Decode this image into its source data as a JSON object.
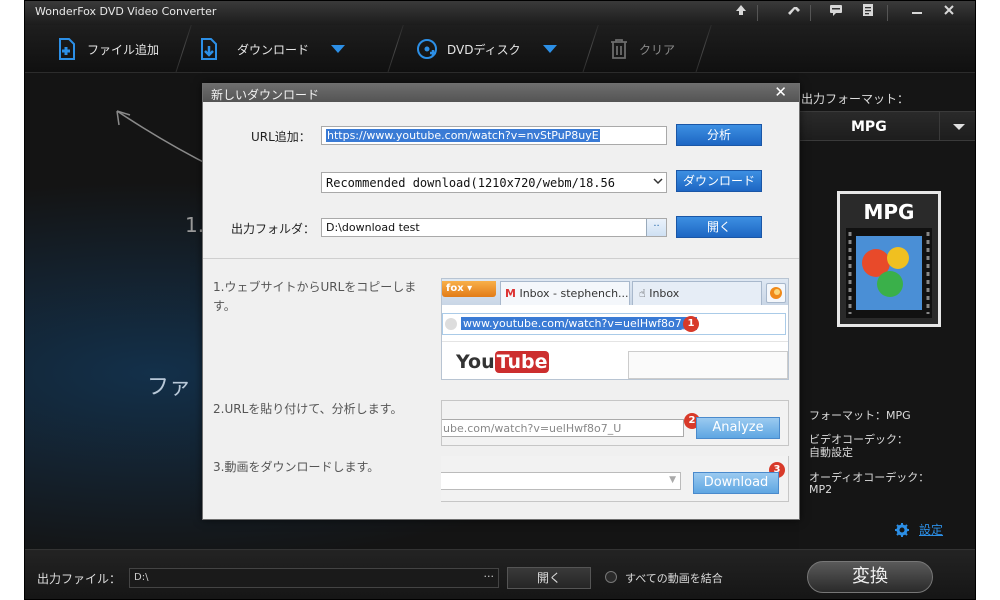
{
  "window": {
    "title": "WonderFox DVD Video Converter"
  },
  "toolbar": {
    "add_file": "ファイル追加",
    "download": "ダウンロード",
    "dvd_disc": "DVDディスク",
    "clear": "クリア"
  },
  "background": {
    "step_number": "1.",
    "step_text_partial": "ファ"
  },
  "right_panel": {
    "output_format_label": "出力フォーマット：",
    "format_value": "MPG",
    "format_icon_text": "MPG",
    "format_info": "フォーマット：MPG",
    "video_codec_label": "ビデオコーデック：",
    "video_codec_value": "自動設定",
    "audio_codec_label": "オーディオコーデック：",
    "audio_codec_value": "MP2",
    "settings_link": "設定"
  },
  "bottom": {
    "output_file_label": "出力ファイル：",
    "output_path": "D:\\",
    "browse": "···",
    "open": "開く",
    "merge_label": "すべての動画を結合",
    "convert": "変換"
  },
  "dialog": {
    "title": "新しいダウンロード",
    "url_label": "URL追加：",
    "url_value": "https://www.youtube.com/watch?v=nvStPuP8uyE",
    "analyze": "分析",
    "quality_value": "Recommended download(1210x720/webm/18.56",
    "download": "ダウンロード",
    "folder_label": "出力フォルダ：",
    "folder_value": "D:\\download test",
    "open": "開く",
    "steps": [
      "1.ウェブサイトからURLをコピーします。",
      "2.URLを貼り付けて、分析します。",
      "3.動画をダウンロードします。"
    ],
    "browser": {
      "tab1": "fox",
      "tab2": "Inbox - stephench...",
      "tab3": "Inbox",
      "address": "www.youtube.com/watch?v=uelHwf8o7_U",
      "youtube_you": "You",
      "youtube_tube": "Tube"
    },
    "example": {
      "url_partial": "ube.com/watch?v=uelHwf8o7_U",
      "analyze_button": "Analyze",
      "download_button": "Download",
      "badge1": "1",
      "badge2": "2",
      "badge3": "3"
    }
  }
}
